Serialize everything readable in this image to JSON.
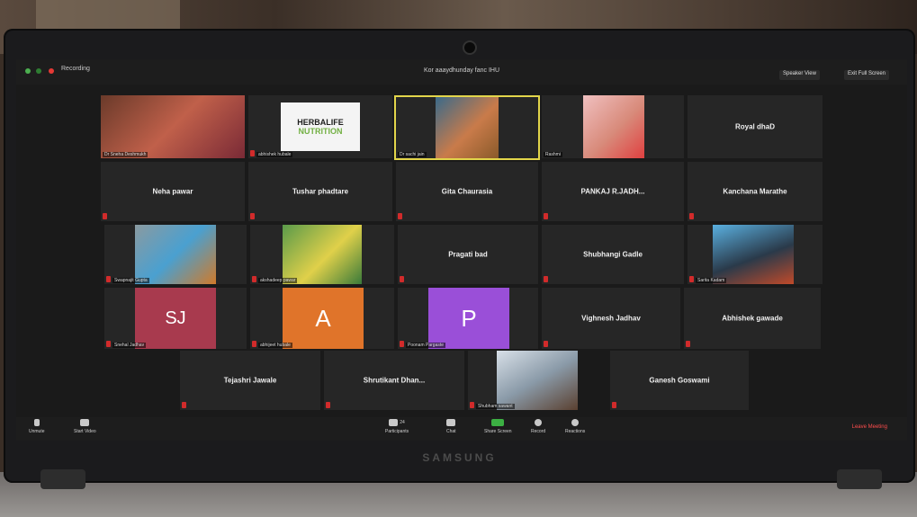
{
  "meeting": {
    "title": "Kor aaaydhunday fanc IHU",
    "recording_label": "Recording",
    "speaker_view": "Speaker View",
    "fullscreen": "Exit Full Screen"
  },
  "tiles": [
    {
      "label": "",
      "nametag": "Dr Sneha Deshmukh",
      "type": "video"
    },
    {
      "label": "",
      "nametag": "abhishek hubale",
      "type": "logo",
      "logo_line1": "HERBALIFE",
      "logo_line2": "NUTRITION"
    },
    {
      "label": "",
      "nametag": "Dr sachi jain",
      "type": "video",
      "active": true
    },
    {
      "label": "",
      "nametag": "Rashmi",
      "type": "video"
    },
    {
      "label": "Royal dhaD",
      "nametag": "",
      "type": "name"
    },
    {
      "label": "Neha pawar",
      "nametag": "",
      "type": "name"
    },
    {
      "label": "Tushar phadtare",
      "nametag": "",
      "type": "name"
    },
    {
      "label": "Gita Chaurasia",
      "nametag": "",
      "type": "name"
    },
    {
      "label": "PANKAJ R.JADH...",
      "nametag": "",
      "type": "name"
    },
    {
      "label": "Kanchana Marathe",
      "nametag": "",
      "type": "name"
    },
    {
      "label": "",
      "nametag": "Swapnajit Gupta",
      "type": "video"
    },
    {
      "label": "",
      "nametag": "akshadeep pawar",
      "type": "video"
    },
    {
      "label": "Pragati bad",
      "nametag": "",
      "type": "name"
    },
    {
      "label": "Shubhangi Gadle",
      "nametag": "",
      "type": "name"
    },
    {
      "label": "",
      "nametag": "Sarita Kadam",
      "type": "video"
    },
    {
      "label": "SJ",
      "nametag": "Snehal Jadhav",
      "type": "avatar",
      "color": "#a83a4e"
    },
    {
      "label": "A",
      "nametag": "abhijeet hubale",
      "type": "avatar",
      "color": "#e0742a"
    },
    {
      "label": "P",
      "nametag": "Poonam Pargaste",
      "type": "avatar",
      "color": "#9a4fd8"
    },
    {
      "label": "Vighnesh Jadhav",
      "nametag": "",
      "type": "name"
    },
    {
      "label": "Abhishek gawade",
      "nametag": "",
      "type": "name"
    },
    {
      "label": "Tejashri Jawale",
      "nametag": "",
      "type": "name"
    },
    {
      "label": "Shrutikant Dhan...",
      "nametag": "",
      "type": "name"
    },
    {
      "label": "",
      "nametag": "Shubham sawant",
      "type": "video"
    },
    {
      "label": "Ganesh Goswami",
      "nametag": "",
      "type": "name"
    }
  ],
  "toolbar": {
    "unmute": "Unmute",
    "start_video": "Start Video",
    "participants": "Participants",
    "participants_count": "24",
    "chat": "Chat",
    "share_screen": "Share Screen",
    "record": "Record",
    "reactions": "Reactions",
    "leave": "Leave Meeting"
  },
  "device": {
    "brand": "SAMSUNG"
  },
  "colors": {
    "active_speaker": "#e2d54a",
    "share_green": "#3cb043",
    "leave_red": "#ff4d4d"
  }
}
